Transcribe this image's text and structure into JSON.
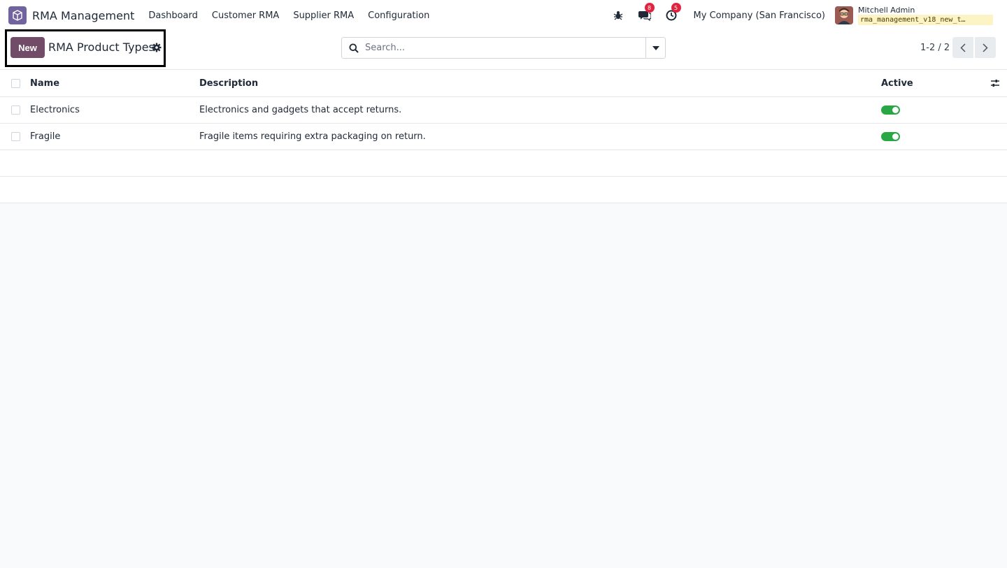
{
  "navbar": {
    "app_name": "RMA Management",
    "menu": [
      "Dashboard",
      "Customer RMA",
      "Supplier RMA",
      "Configuration"
    ],
    "messages_count": "8",
    "activities_count": "5",
    "company": "My Company (San Francisco)",
    "user_name": "Mitchell Admin",
    "database": "rma_management_v18_new_t…"
  },
  "control_panel": {
    "new_label": "New",
    "title": "RMA Product Types",
    "search_placeholder": "Search...",
    "pager": "1-2 / 2"
  },
  "list": {
    "columns": [
      "Name",
      "Description",
      "Active"
    ],
    "rows": [
      {
        "name": "Electronics",
        "description": "Electronics and gadgets that accept returns.",
        "active": true
      },
      {
        "name": "Fragile",
        "description": "Fragile items requiring extra packaging on return.",
        "active": true
      }
    ]
  },
  "colors": {
    "brand": "#714b67",
    "toggle_on": "#28a745",
    "badge": "#e0243f"
  }
}
